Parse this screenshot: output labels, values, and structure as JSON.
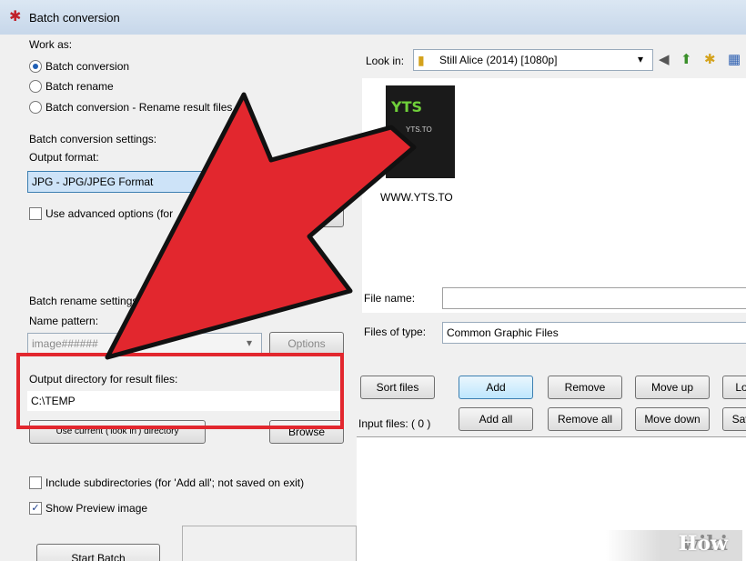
{
  "window": {
    "title": "Batch conversion"
  },
  "left": {
    "work_as_label": "Work as:",
    "work_as_options": [
      "Batch conversion",
      "Batch rename",
      "Batch conversion - Rename result files"
    ],
    "conversion_settings_label": "Batch conversion settings:",
    "output_format_label": "Output format:",
    "output_format_value": "JPG - JPG/JPEG Format",
    "advanced_options_label": "Use advanced options (for",
    "rename_settings_label": "Batch rename settings",
    "name_pattern_label": "Name pattern:",
    "name_pattern_value": "image######",
    "options_button": "Options",
    "output_dir_label": "Output directory for result files:",
    "output_dir_value": "C:\\TEMP",
    "use_current_button": "Use current ('look in') directory",
    "browse_button": "Browse",
    "include_subdirs_label": "Include subdirectories (for 'Add all'; not saved on exit)",
    "show_preview_label": "Show Preview image",
    "start_batch_button": "Start Batch"
  },
  "right": {
    "look_in_label": "Look in:",
    "look_in_value": "Still Alice (2014) [1080p]",
    "thumbnail_logo": "YTS",
    "thumbnail_sub": "YTS.TO",
    "thumbnail_caption": "WWW.YTS.TO",
    "file_name_label": "File name:",
    "files_of_type_label": "Files of type:",
    "files_of_type_value": "Common Graphic Files",
    "sort_files_button": "Sort files",
    "add_button": "Add",
    "remove_button": "Remove",
    "move_up_button": "Move up",
    "load_button": "Lo",
    "input_files_label": "Input files: ( 0 )",
    "add_all_button": "Add all",
    "remove_all_button": "Remove all",
    "move_down_button": "Move down",
    "save_button": "Sav"
  },
  "watermark": {
    "wiki": "wiki",
    "how": "How"
  },
  "colors": {
    "highlight": "#e2272e",
    "arrow": "#e2272e"
  }
}
